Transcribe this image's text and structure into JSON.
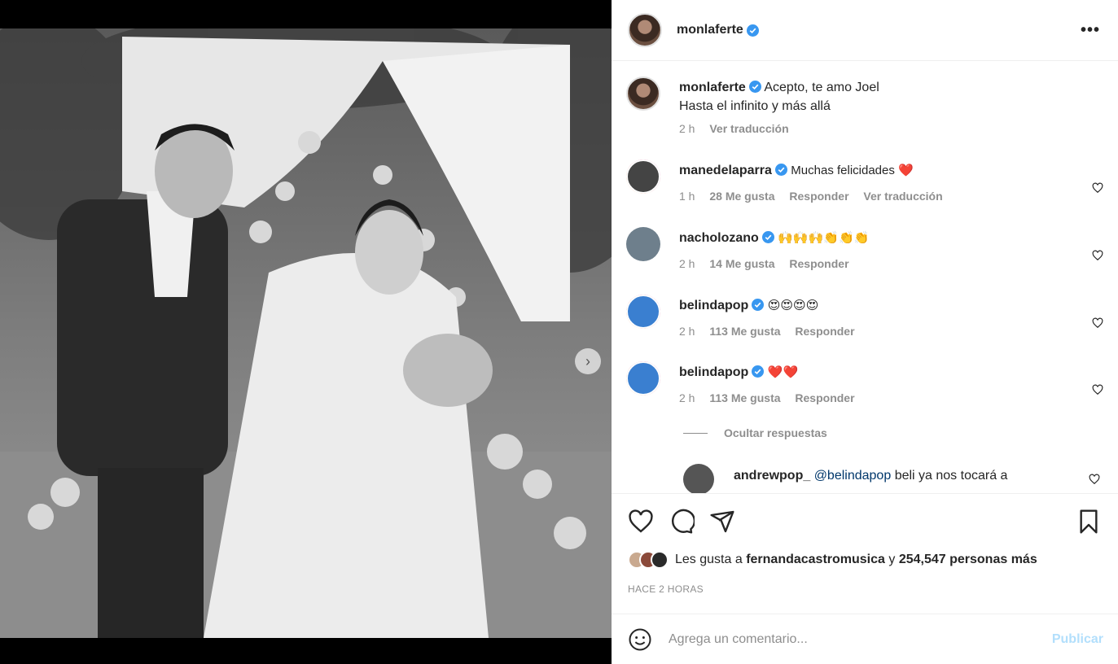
{
  "post": {
    "username": "monlaferte",
    "more_icon": "more-horizontal-icon",
    "caption_line1": "Acepto, te amo Joel",
    "caption_line2": "Hasta el infinito y más allá",
    "caption_time": "2 h",
    "caption_translate": "Ver traducción"
  },
  "comments": [
    {
      "user": "manedelaparra",
      "text": "Muchas felicidades ❤️",
      "time": "1 h",
      "likes": "28 Me gusta",
      "reply": "Responder",
      "translate": "Ver traducción"
    },
    {
      "user": "nacholozano",
      "text": "🙌🙌🙌👏👏👏",
      "time": "2 h",
      "likes": "14 Me gusta",
      "reply": "Responder"
    },
    {
      "user": "belindapop",
      "text": "😍😍😍😍",
      "time": "2 h",
      "likes": "113 Me gusta",
      "reply": "Responder"
    },
    {
      "user": "belindapop",
      "text": "❤️❤️",
      "time": "2 h",
      "likes": "113 Me gusta",
      "reply": "Responder"
    }
  ],
  "hide_replies": "Ocultar respuestas",
  "reply": {
    "user": "andrewpop_",
    "mention": "@belindapop",
    "text": "beli ya nos tocará a"
  },
  "likes": {
    "prefix": "Les gusta a",
    "user": "fernandacastromusica",
    "joiner": "y",
    "count": "254,547 personas más"
  },
  "timestamp": "HACE 2 HORAS",
  "add_comment": {
    "placeholder": "Agrega un comentario...",
    "publish": "Publicar"
  },
  "colors": {
    "accent": "#0095f6",
    "publish_disabled": "#b2dffc",
    "verified": "#3897f0"
  }
}
